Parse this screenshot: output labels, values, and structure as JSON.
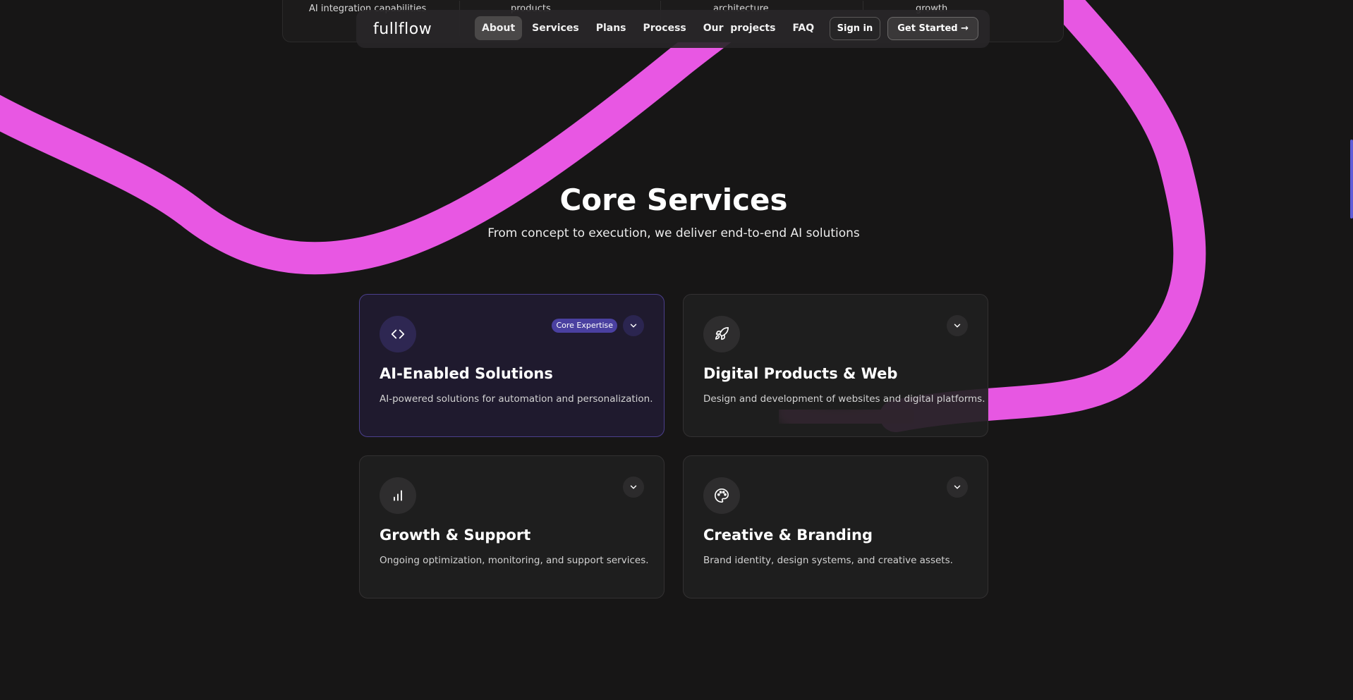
{
  "background": {
    "stroke_color": "#ee50e8",
    "page_color": "#171616",
    "accent_color": "#4a40a0"
  },
  "stats_strip": {
    "items": [
      {
        "text": "AI integration capabilities"
      },
      {
        "text": "products"
      },
      {
        "text": "architecture"
      },
      {
        "text": "growth"
      }
    ]
  },
  "nav": {
    "logo": "fullflow",
    "links": [
      {
        "label": "About",
        "active": true
      },
      {
        "label": "Services",
        "active": false
      },
      {
        "label": "Plans",
        "active": false
      },
      {
        "label": "Process",
        "active": false
      },
      {
        "label": "Our  projects",
        "active": false
      },
      {
        "label": "FAQ",
        "active": false
      }
    ],
    "sign_in_label": "Sign in",
    "get_started_label": "Get Started →"
  },
  "services": {
    "title": "Core Services",
    "subtitle": "From concept to execution, we deliver end-to-end AI solutions",
    "cards": [
      {
        "icon": "code-icon",
        "badge": "Core Expertise",
        "title": "AI-Enabled Solutions",
        "description": "AI-powered solutions for automation and personalization."
      },
      {
        "icon": "rocket-icon",
        "title": "Digital Products & Web",
        "description": "Design and development of websites and digital platforms."
      },
      {
        "icon": "bar-chart-icon",
        "title": "Growth & Support",
        "description": "Ongoing optimization, monitoring, and support services."
      },
      {
        "icon": "palette-icon",
        "title": "Creative & Branding",
        "description": "Brand identity, design systems, and creative assets."
      }
    ]
  }
}
